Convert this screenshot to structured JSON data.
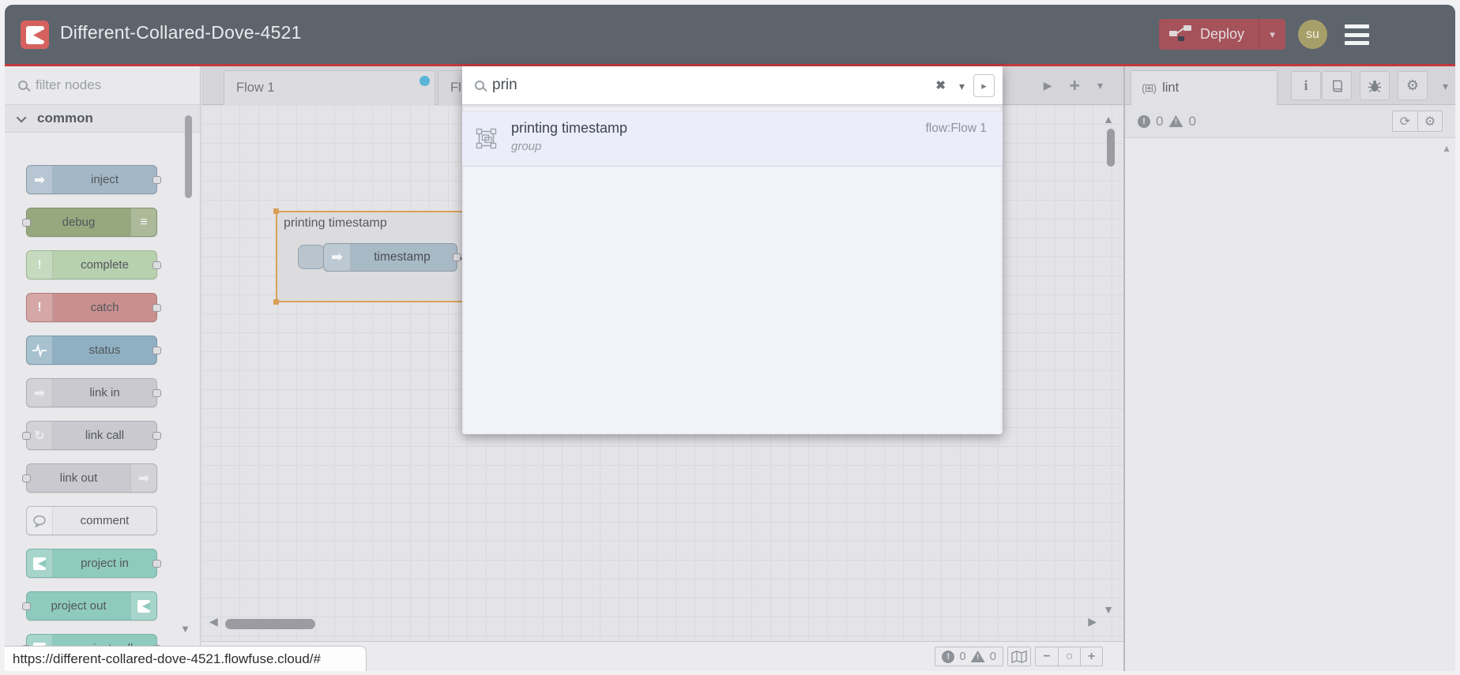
{
  "colors": {
    "header_bg": "#5d646c",
    "accent_red": "#c23a3f",
    "logo_red": "#d5625e",
    "deploy_bg": "#a6525b",
    "avatar_bg": "#a79f6a",
    "tab_dot_blue": "#5ab5d6",
    "group_border_orange": "#d9a058",
    "inject_node": "#a3b7c6",
    "debug_node": "#97a77e",
    "complete_node": "#b7d0ae",
    "catch_node": "#c98f8f",
    "status_node": "#8fb0c2",
    "link_node": "#c9c9cf",
    "project_node": "#8fcabe"
  },
  "header": {
    "title": "Different-Collared-Dove-4521",
    "deploy_label": "Deploy",
    "avatar_initials": "su"
  },
  "palette": {
    "filter_placeholder": "filter nodes",
    "category_label": "common",
    "nodes": [
      {
        "label": "inject",
        "glyph": "➡"
      },
      {
        "label": "debug",
        "glyph": "≡"
      },
      {
        "label": "complete",
        "glyph": "!"
      },
      {
        "label": "catch",
        "glyph": "!"
      },
      {
        "label": "status",
        "glyph": ""
      },
      {
        "label": "link in",
        "glyph": "➡"
      },
      {
        "label": "link call",
        "glyph": "↻"
      },
      {
        "label": "link out",
        "glyph": "➡"
      },
      {
        "label": "comment",
        "glyph": ""
      },
      {
        "label": "project in",
        "glyph": ""
      },
      {
        "label": "project out",
        "glyph": ""
      },
      {
        "label": "project call",
        "glyph": ""
      }
    ]
  },
  "tabs": {
    "flow1_label": "Flow 1",
    "partial_label": "Fl"
  },
  "workspace": {
    "group_label": "printing timestamp",
    "node_label": "timestamp"
  },
  "search": {
    "query": "prin",
    "result_title": "printing timestamp",
    "result_type": "group",
    "result_flow": "flow:Flow 1"
  },
  "sidebar": {
    "tab_label": "lint",
    "error_count": "0",
    "warning_count": "0",
    "plugin_icon": "(⊞)"
  },
  "footer": {
    "error_count": "0",
    "warning_count": "0"
  },
  "statusbar": {
    "url": "https://different-collared-dove-4521.flowfuse.cloud/#"
  },
  "icons": {
    "clear": "✖",
    "dropdown": "▾",
    "open": "▸",
    "play": "▶",
    "add": "+",
    "zoom_out": "−",
    "zoom_reset": "○",
    "zoom_in": "+",
    "gear": "⚙",
    "refresh": "⟳",
    "info": "i",
    "tri_up": "▲",
    "tri_down": "▼",
    "tri_left": "◀",
    "tri_right": "▶",
    "small_down": "▼"
  }
}
